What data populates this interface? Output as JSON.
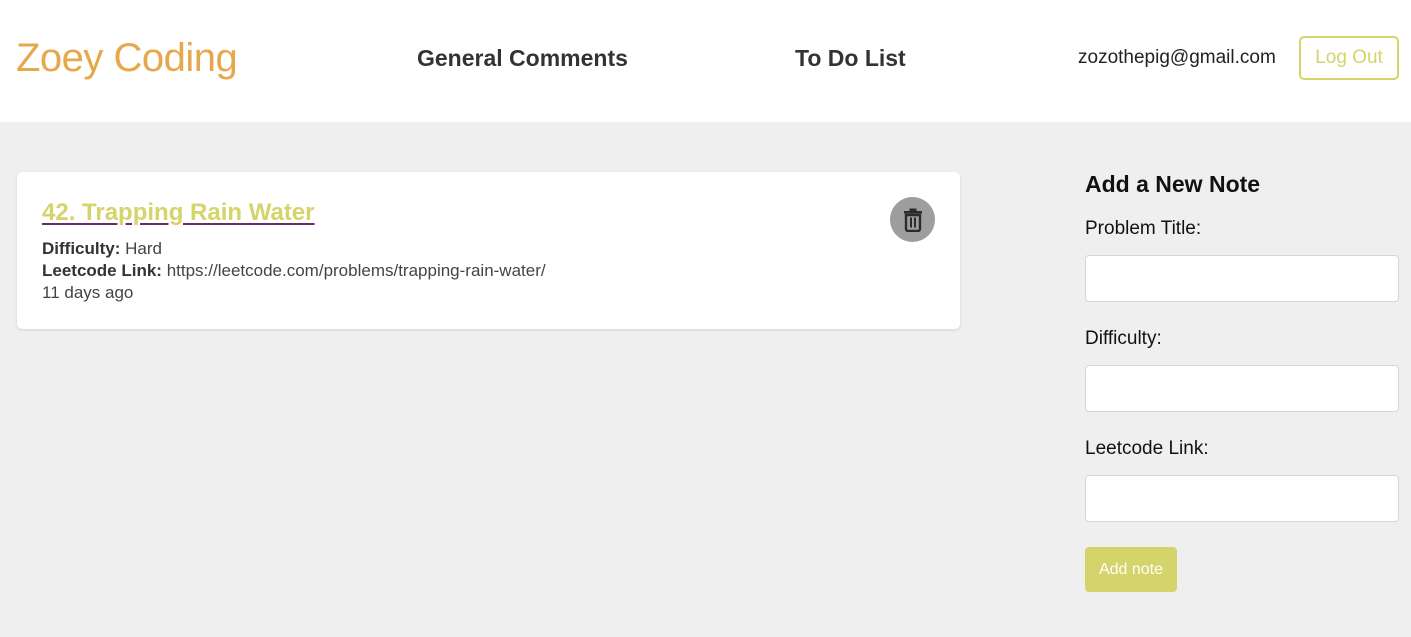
{
  "header": {
    "brand": "Zoey Coding",
    "nav": {
      "general_comments": "General Comments",
      "todo_list": "To Do List"
    },
    "user_email": "zozothepig@gmail.com",
    "logout_label": "Log Out"
  },
  "note": {
    "title": "42. Trapping Rain Water",
    "difficulty_label": "Difficulty:",
    "difficulty_value": "Hard",
    "link_label": "Leetcode Link:",
    "link_value": "https://leetcode.com/problems/trapping-rain-water/",
    "age": "11 days ago",
    "delete_icon": "trash-icon"
  },
  "sidebar": {
    "heading": "Add a New Note",
    "fields": {
      "problem_title": {
        "label": "Problem Title:",
        "value": ""
      },
      "difficulty": {
        "label": "Difficulty:",
        "value": ""
      },
      "leetcode_link": {
        "label": "Leetcode Link:",
        "value": ""
      }
    },
    "submit_label": "Add note"
  },
  "colors": {
    "brand": "#e6a84a",
    "accent": "#d4d46a",
    "background": "#efefef",
    "delete_button": "#9e9e9e"
  }
}
